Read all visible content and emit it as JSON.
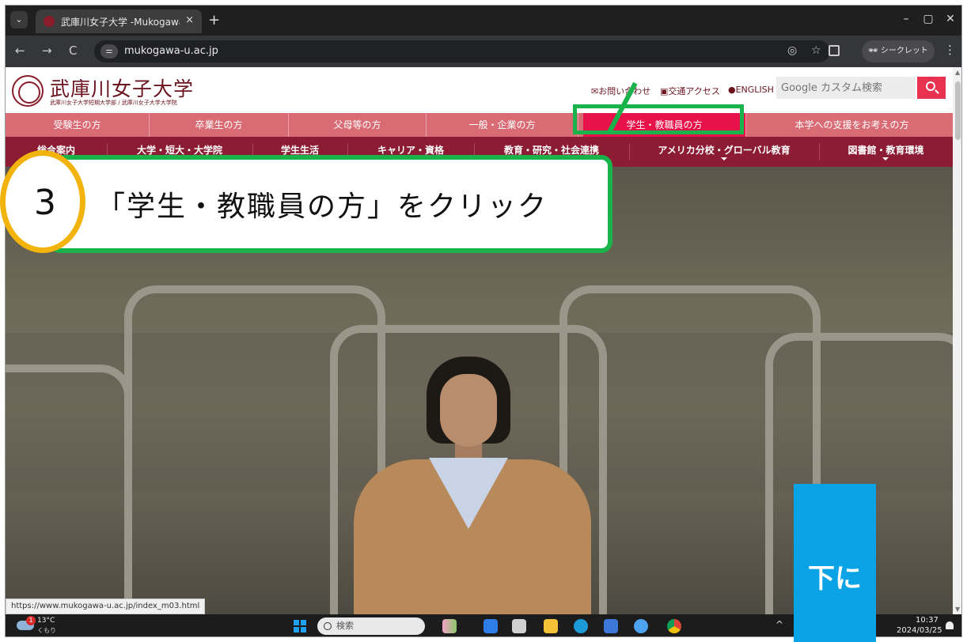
{
  "browser": {
    "tab_title": "武庫川女子大学 -Mukogawa W",
    "tab_close": "×",
    "new_tab": "+",
    "window_controls": {
      "minimize": "–",
      "restore": "▢",
      "close": "✕"
    },
    "nav": {
      "back": "←",
      "forward": "→",
      "reload": "C"
    },
    "url": "mukogawa-u.ac.jp",
    "site_info_icon": "tune-icon",
    "incognito_label": "シークレット",
    "menu": "⋮"
  },
  "site": {
    "logo_name": "武庫川女子大学",
    "logo_sub": "武庫川女子大学短期大学部 / 武庫川女子大学大学院",
    "util_links": [
      "お問い合わせ",
      "交通アクセス",
      "ENGLISH"
    ],
    "search_placeholder": "Google カスタム検索",
    "audience_nav": [
      "受験生の方",
      "卒業生の方",
      "父母等の方",
      "一般・企業の方",
      "学生・教職員の方",
      "本学への支援をお考えの方"
    ],
    "main_nav": [
      "総合案内",
      "大学・短大・大学院",
      "学生生活",
      "キャリア・資格",
      "教育・研究・社会連携",
      "アメリカ分校・グローバル教育",
      "図書館・教育環境"
    ],
    "status_url": "https://www.mukogawa-u.ac.jp/index_m03.html",
    "accent_color": "#e8124a",
    "nav_color": "#8b1c33"
  },
  "annotation": {
    "step_number": "3",
    "instruction": "「学生・教職員の方」をクリック",
    "scroll_hint": "下に"
  },
  "taskbar": {
    "weather_badge": "1",
    "temperature": "13°C",
    "condition": "くもり",
    "search_label": "検索",
    "tray_chevron": "^",
    "time": "10:37",
    "date": "2024/03/25"
  }
}
